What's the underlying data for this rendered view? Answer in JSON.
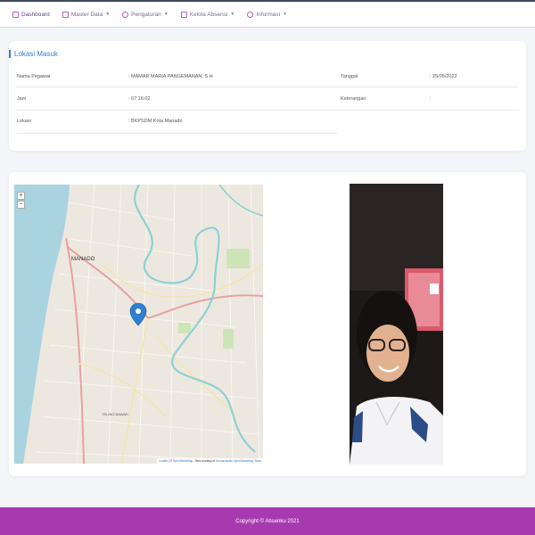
{
  "nav": {
    "items": [
      {
        "label": "Dashboard",
        "has_caret": false
      },
      {
        "label": "Master Data",
        "has_caret": true
      },
      {
        "label": "Pengaturan",
        "has_caret": true
      },
      {
        "label": "Kelola Absensi",
        "has_caret": true
      },
      {
        "label": "Informasi",
        "has_caret": true
      }
    ],
    "caret": "▼"
  },
  "lokasi_card": {
    "title": "Lokasi Masuk",
    "nama_label": "Nama Pegawai",
    "nama_value": ": MAMAR MARIA PANGEMANAN, S.H",
    "tanggal_label": "Tanggal",
    "tanggal_value": ": 25/05/2022",
    "jam_label": "Jam",
    "jam_value": ": 07:16:02",
    "keterangan_label": "Keterangan",
    "keterangan_value": ":",
    "lokasi_label": "Lokasi",
    "lokasi_value": ": BKPSDM Kota Manado"
  },
  "map": {
    "zoom_in": "+",
    "zoom_out": "−",
    "city_label": "MANADO",
    "district_label": "TELING BAWAH",
    "attribution_leaflet": "Leaflet",
    "attribution_osm": "OpenStreetMap",
    "attribution_tiles": "Tiles courtesy of",
    "attribution_hot": "Humanitarian OpenStreetMap Team",
    "colors": {
      "sea": "#a9d3df",
      "river": "#8fd0d6",
      "major_road": "#e8a1a1",
      "road": "#f2e6b0",
      "land": "#ede8df",
      "marker": "#2f7fd1"
    }
  },
  "footer": {
    "text": "Copyright © Absenku 2021"
  },
  "colors": {
    "accent": "#2f7fd1",
    "footer_bg": "#a83aaf",
    "nav_icon": "#b05fc4"
  }
}
